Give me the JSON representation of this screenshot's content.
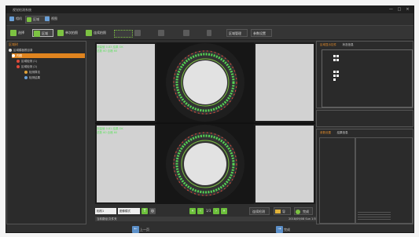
{
  "window": {
    "title": "视觉检测系统",
    "controls": [
      "—",
      "□",
      "×"
    ]
  },
  "menu": [
    {
      "label": "相机",
      "color": "#6aa0d8"
    },
    {
      "label": "区域",
      "color": "#7cc242",
      "active": true
    },
    {
      "label": "视图",
      "color": "#6aa0d8"
    }
  ],
  "toolbar": {
    "select": "选择",
    "region": "区域",
    "single": "单次拍照",
    "continuous": "连续拍照",
    "region_mgmt": "区域管理",
    "params": "参数设置"
  },
  "left_panel": {
    "title": "区域树",
    "rows": [
      {
        "label": "区域模板根目录",
        "hl": false,
        "depth": 0
      },
      {
        "label": "内圈",
        "hl": true,
        "depth": 1
      },
      {
        "label": "区域检测 (1)",
        "hl": false,
        "depth": 2
      },
      {
        "label": "区域检测 (2)",
        "hl": false,
        "depth": 2
      },
      {
        "label": "检测算法",
        "hl": false,
        "depth": 3
      },
      {
        "label": "检测结果",
        "hl": false,
        "depth": 3
      }
    ]
  },
  "viewer": {
    "top_meas": [
      "测量值 0.83  结果 OK",
      "总数 60  合格 60"
    ],
    "bottom_meas": [
      "测量值 0.81  结果 OK",
      "总数 60  合格 60"
    ]
  },
  "nav": {
    "camera": "相机1",
    "mode": "图像模式",
    "page": "1/3",
    "continue_label": "连续检测",
    "import_label": "导入",
    "ok_label": "完成"
  },
  "status": {
    "left": "当前路径/文件夹",
    "right": "2018/09/08 Sun 1:56"
  },
  "right_panel": {
    "title": "区域显示控件",
    "tab2": "状态信息"
  },
  "right_lower": {
    "tab1": "参数设置",
    "tab2": "结果信息"
  },
  "bottom": {
    "prev": "上一页",
    "next": "完成"
  },
  "colors": {
    "accent": "#e0841f",
    "green": "#7cc242"
  }
}
